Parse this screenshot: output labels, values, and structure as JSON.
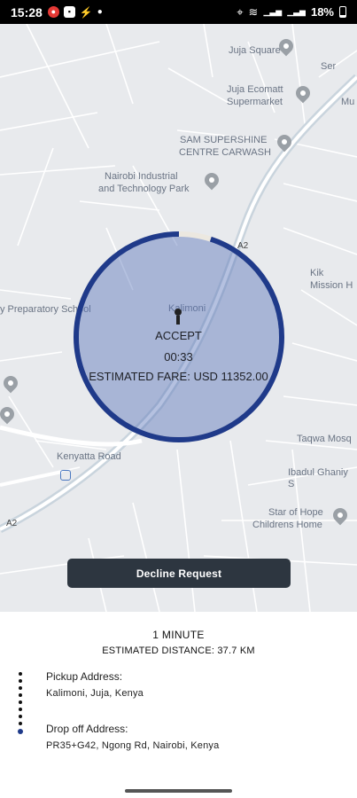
{
  "status_bar": {
    "time": "15:28",
    "battery": "18%",
    "network_1": "Vo) LTE1",
    "network_2": "Vo) LTE2"
  },
  "map": {
    "places": {
      "juja_square": "Juja Square",
      "juja_ecomatt": "Juja Ecomatt",
      "supermarket": "Supermarket",
      "sam_supershine": "SAM SUPERSHINE",
      "centre_carwash": "CENTRE CARWASH",
      "nairobi_industrial": "Nairobi Industrial",
      "tech_park": "and Technology Park",
      "prep_school": "y Preparatory School",
      "kalimoni": "Kalimoni",
      "kenyatta_road": "Kenyatta Road",
      "taqwa": "Taqwa Mosq",
      "ibadul": "Ibadul Ghaniy S",
      "star_of_hope": "Star of Hope",
      "childrens_home": "Childrens Home",
      "kik": "Kik",
      "mission": "Mission H",
      "mu": "Mu",
      "ser": "Ser",
      "road_a2_top": "A2",
      "road_a2_bottom": "A2"
    }
  },
  "request": {
    "status": "ACCEPT",
    "countdown": "00:33",
    "fare": "ESTIMATED FARE: USD 11352.00",
    "timer_progress": 0.95
  },
  "actions": {
    "decline_label": "Decline Request"
  },
  "trip": {
    "duration": "1 MINUTE",
    "distance": "ESTIMATED DISTANCE: 37.7 KM",
    "pickup_label": "Pickup Address:",
    "pickup_value": "Kalimoni, Juja, Kenya",
    "dropoff_label": "Drop off Address:",
    "dropoff_value": "PR35+G42, Ngong Rd, Nairobi, Kenya"
  },
  "colors": {
    "ring": "#1f3a8a",
    "circle_fill": "#5c76ba",
    "button_bg": "#2d3640"
  }
}
